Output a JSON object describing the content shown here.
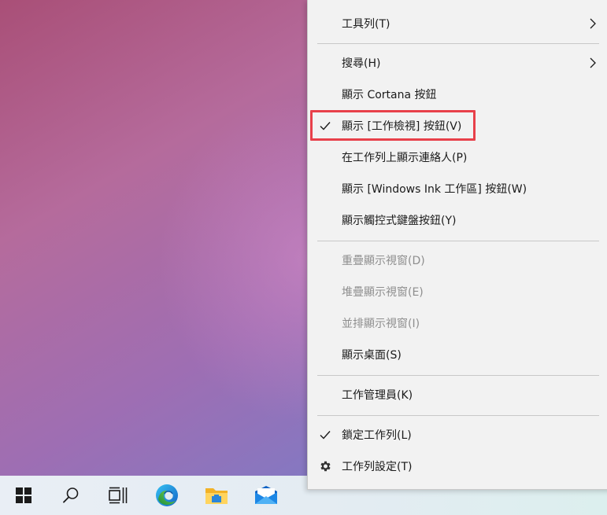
{
  "taskbar": {
    "buttons": [
      {
        "name": "start",
        "icon": "windows-logo-icon"
      },
      {
        "name": "search",
        "icon": "search-icon"
      },
      {
        "name": "task-view",
        "icon": "task-view-icon"
      },
      {
        "name": "edge",
        "icon": "edge-browser-icon"
      },
      {
        "name": "file-explorer",
        "icon": "folder-icon"
      },
      {
        "name": "mail",
        "icon": "mail-icon"
      }
    ]
  },
  "menu": {
    "items": [
      {
        "label": "工具列(T)",
        "submenu": true,
        "checked": false,
        "disabled": false
      },
      {
        "label": "搜尋(H)",
        "submenu": true,
        "checked": false,
        "disabled": false
      },
      {
        "label": "顯示 Cortana 按鈕",
        "submenu": false,
        "checked": false,
        "disabled": false
      },
      {
        "label": "顯示 [工作檢視] 按鈕(V)",
        "submenu": false,
        "checked": true,
        "disabled": false
      },
      {
        "label": "在工作列上顯示連絡人(P)",
        "submenu": false,
        "checked": false,
        "disabled": false
      },
      {
        "label": "顯示 [Windows Ink 工作區] 按鈕(W)",
        "submenu": false,
        "checked": false,
        "disabled": false
      },
      {
        "label": "顯示觸控式鍵盤按鈕(Y)",
        "submenu": false,
        "checked": false,
        "disabled": false
      },
      {
        "label": "重疊顯示視窗(D)",
        "submenu": false,
        "checked": false,
        "disabled": true
      },
      {
        "label": "堆疊顯示視窗(E)",
        "submenu": false,
        "checked": false,
        "disabled": true
      },
      {
        "label": "並排顯示視窗(I)",
        "submenu": false,
        "checked": false,
        "disabled": true
      },
      {
        "label": "顯示桌面(S)",
        "submenu": false,
        "checked": false,
        "disabled": false
      },
      {
        "label": "工作管理員(K)",
        "submenu": false,
        "checked": false,
        "disabled": false
      },
      {
        "label": "鎖定工作列(L)",
        "submenu": false,
        "checked": true,
        "disabled": false
      },
      {
        "label": "工作列設定(T)",
        "submenu": false,
        "checked": false,
        "disabled": false,
        "icon": "gear-icon"
      }
    ]
  },
  "colors": {
    "highlight": "#e8404a",
    "menu_background": "#f2f2f2",
    "disabled_text": "#8e8e8e"
  }
}
